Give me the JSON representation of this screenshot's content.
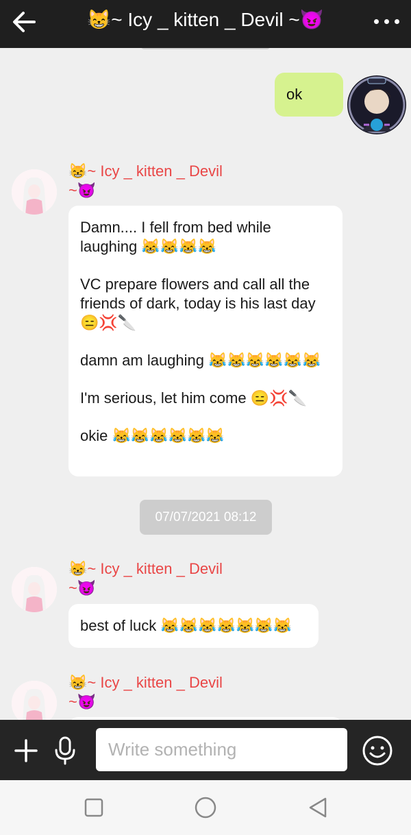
{
  "header": {
    "title": "😸~ Icy _ kitten _ Devil ~😈"
  },
  "messages": {
    "outgoing": {
      "text": "ok"
    },
    "msg1": {
      "sender_line1": "😸~ Icy _ kitten _ Devil",
      "sender_line2": "~😈",
      "paragraphs": [
        "Damn.... I fell from bed while laughing 😹😹😹😹",
        "VC prepare flowers and call all the friends of dark, today is his last day 😑💢🔪",
        "damn am laughing 😹😹😹😹😹😹",
        "I'm serious, let him come 😑💢🔪",
        "okie 😹😹😹😹😹😹"
      ]
    },
    "timestamp": "07/07/2021 08:12",
    "msg2": {
      "sender_line1": "😸~ Icy _ kitten _ Devil",
      "sender_line2": "~😈",
      "text": "best of luck 😹😹😹😹😹😹😹"
    },
    "msg3": {
      "sender_line1": "😸~ Icy _ kitten _ Devil",
      "sender_line2": "~😈"
    }
  },
  "composer": {
    "placeholder": "Write something"
  },
  "icons": {
    "back": "arrow-left-icon",
    "more": "more-horizontal-icon",
    "plus": "plus-icon",
    "mic": "microphone-icon",
    "emoji": "emoji-icon",
    "nav": [
      "square-icon",
      "circle-icon",
      "triangle-back-icon"
    ]
  },
  "colors": {
    "topbar": "#1f1f1f",
    "outgoing_bubble": "#d6f28f",
    "sender_name": "#e94646",
    "timestamp_bg": "#cdcdcd"
  }
}
